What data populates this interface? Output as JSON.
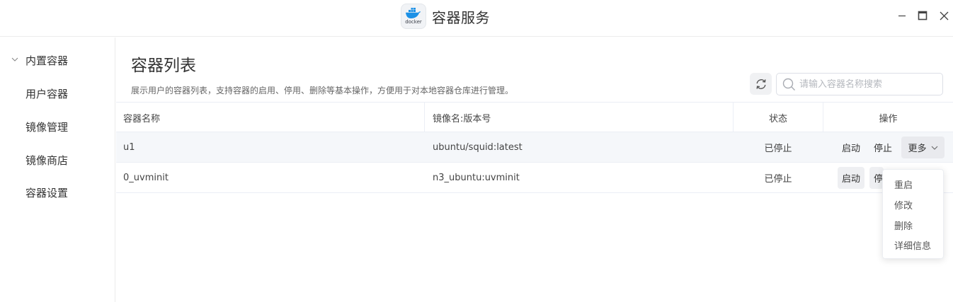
{
  "window": {
    "app_title": "容器服务",
    "logo_word": "docker",
    "logo_color": "#1d91e6",
    "icons": {
      "minimize": "minimize-icon",
      "maximize": "maximize-icon",
      "close": "close-icon"
    }
  },
  "sidebar": {
    "items": [
      {
        "label": "内置容器",
        "expanded": true
      },
      {
        "label": "用户容器"
      },
      {
        "label": "镜像管理"
      },
      {
        "label": "镜像商店"
      },
      {
        "label": "容器设置"
      }
    ]
  },
  "main": {
    "title": "容器列表",
    "description": "展示用户的容器列表，支持容器的启用、停用、删除等基本操作，方便用于对本地容器仓库进行管理。",
    "search": {
      "placeholder": "请输入容器名称搜索",
      "value": ""
    },
    "refresh_icon": "refresh-icon",
    "search_icon": "search-icon"
  },
  "table": {
    "columns": [
      "容器名称",
      "镜像名:版本号",
      "状态",
      "操作"
    ],
    "rows": [
      {
        "name": "u1",
        "image": "ubuntu/squid:latest",
        "status": "已停止",
        "actions": [
          "启动",
          "停止",
          "更多"
        ]
      },
      {
        "name": "0_uvminit",
        "image": "n3_ubuntu:uvminit",
        "status": "已停止",
        "actions": [
          "启动",
          "停"
        ]
      }
    ]
  },
  "dropdown": {
    "items": [
      "重启",
      "修改",
      "删除",
      "详细信息"
    ]
  }
}
